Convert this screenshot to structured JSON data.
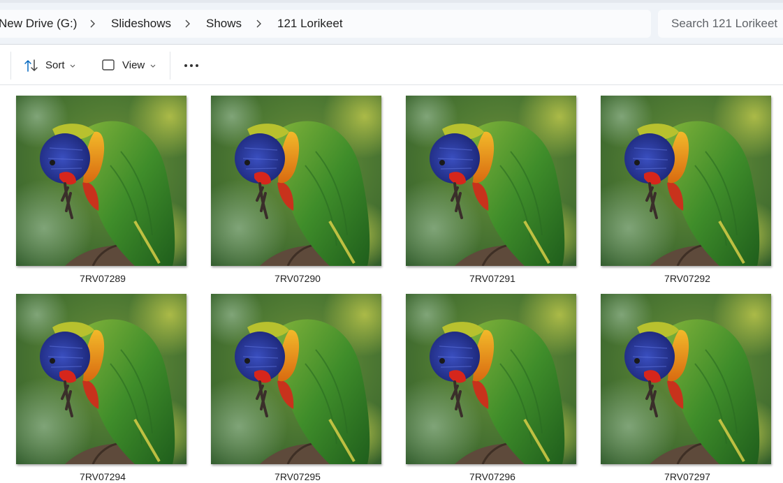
{
  "breadcrumb": {
    "items": [
      "New Drive (G:)",
      "Slideshows",
      "Shows",
      "121 Lorikeet"
    ]
  },
  "search": {
    "placeholder": "Search 121 Lorikeet"
  },
  "toolbar": {
    "sort_label": "Sort",
    "view_label": "View",
    "more_label": "..."
  },
  "files": [
    {
      "name": "7RV07289"
    },
    {
      "name": "7RV07290"
    },
    {
      "name": "7RV07291"
    },
    {
      "name": "7RV07292"
    },
    {
      "name": "7RV07294"
    },
    {
      "name": "7RV07295"
    },
    {
      "name": "7RV07296"
    },
    {
      "name": "7RV07297"
    }
  ],
  "colors": {
    "address_bar_bg": "#eff3f8",
    "accent": "#0067c0"
  }
}
